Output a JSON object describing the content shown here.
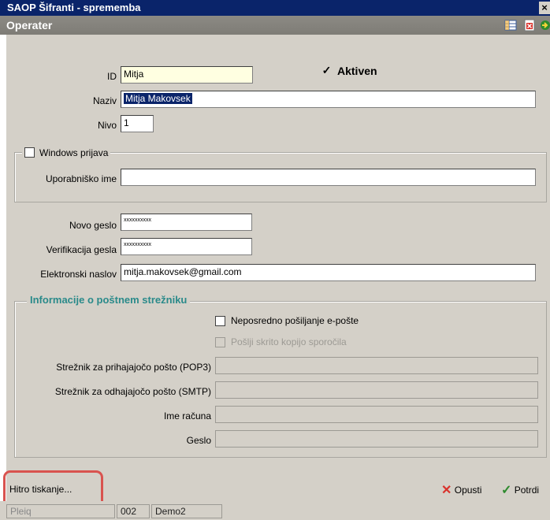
{
  "window": {
    "title": "SAOP Šifranti - sprememba",
    "close_label": "×"
  },
  "header": {
    "title": "Operater",
    "icons": [
      "table-icon",
      "cancel-doc-icon",
      "exit-icon"
    ]
  },
  "form": {
    "id_label": "ID",
    "id_value": "Mitja",
    "aktiven_label": "Aktiven",
    "aktiven_checked": true,
    "naziv_label": "Naziv",
    "naziv_value": "Mitja Makovsek",
    "nivo_label": "Nivo",
    "nivo_value": "1",
    "windows_group_label": "Windows prijava",
    "windows_checked": false,
    "username_label": "Uporabniško ime",
    "username_value": "",
    "new_password_label": "Novo geslo",
    "new_password_value": "xxxxxxxxxx",
    "verify_password_label": "Verifikacija gesla",
    "verify_password_value": "xxxxxxxxxx",
    "email_label": "Elektronski naslov",
    "email_value": "mitja.makovsek@gmail.com"
  },
  "mail": {
    "group_label": "Informacije o poštnem strežniku",
    "direct_send_label": "Neposredno pošiljanje e-pošte",
    "direct_send_checked": false,
    "hidden_copy_label": "Pošlji skrito kopijo sporočila",
    "hidden_copy_checked": false,
    "pop3_label": "Strežnik za prihajajočo pošto (POP3)",
    "pop3_value": "",
    "smtp_label": "Strežnik za odhajajočo pošto (SMTP)",
    "smtp_value": "",
    "account_label": "Ime računa",
    "account_value": "",
    "password_label": "Geslo",
    "password_value": ""
  },
  "footer": {
    "quick_print_label": "Hitro tiskanje...",
    "cancel_label": "Opusti",
    "confirm_label": "Potrdi"
  },
  "statusbar": {
    "cell1": "Pleiq",
    "cell2": "002",
    "cell3": "Demo2"
  },
  "colors": {
    "titlebar": "#0a246a",
    "header": "#858379",
    "form_bg": "#d4d0c8",
    "group_title": "#2a8a8a",
    "id_highlight": "#ffffe1",
    "selection": "#0a246a",
    "annotation": "#d9534f"
  }
}
